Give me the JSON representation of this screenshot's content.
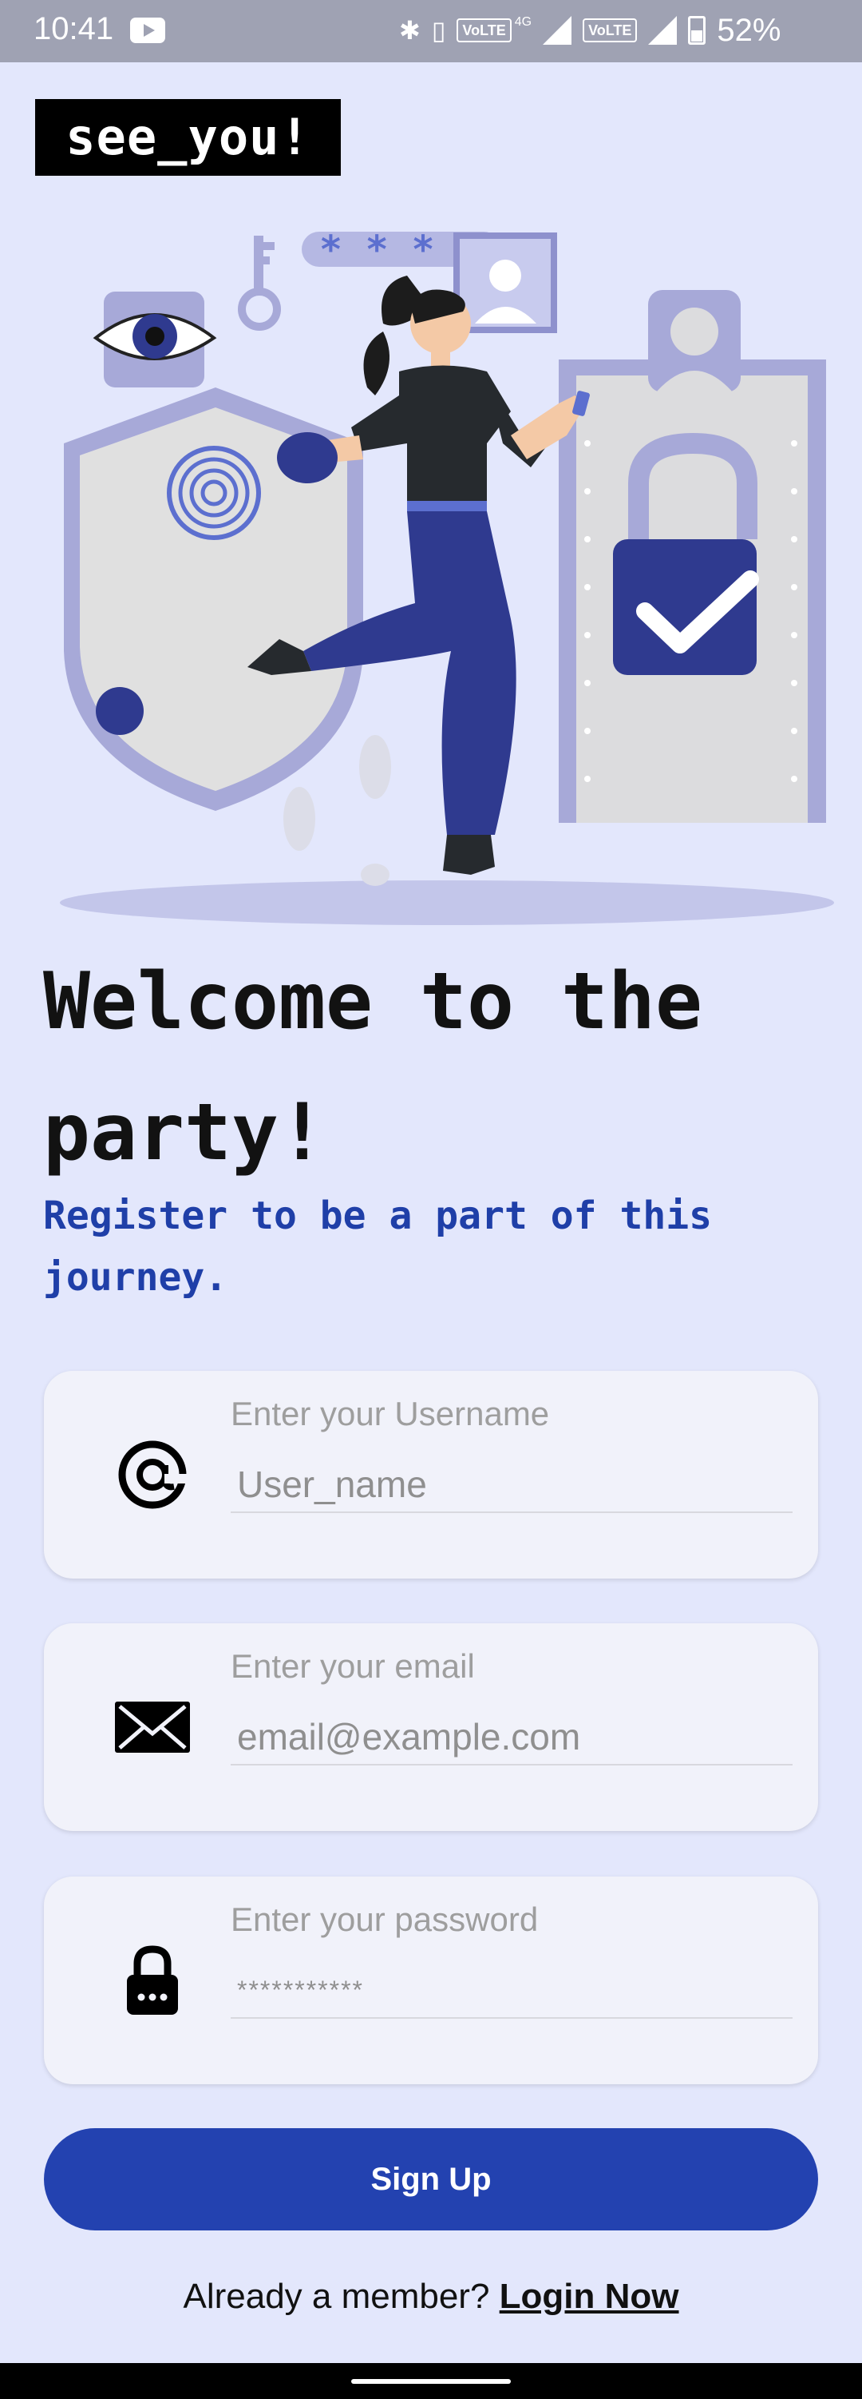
{
  "status_bar": {
    "time": "10:41",
    "volte_1": "VoLTE",
    "network": "4G",
    "volte_2": "VoLTE",
    "battery": "52%"
  },
  "logo": {
    "text": "see_you!"
  },
  "illustration": {
    "stars": "* * * *"
  },
  "welcome": {
    "title": "Welcome to the party!",
    "subtitle": "Register to be a part of this journey."
  },
  "form": {
    "username": {
      "label": "Enter your Username",
      "placeholder": "User_name",
      "icon": "at-sign-icon"
    },
    "email": {
      "label": "Enter your email",
      "placeholder": "email@example.com",
      "icon": "envelope-icon"
    },
    "password": {
      "label": "Enter your password",
      "placeholder": "***********",
      "icon": "lock-icon"
    },
    "signup_label": "Sign Up"
  },
  "footer": {
    "prompt": "Already a member?",
    "login_label": "Login Now"
  },
  "colors": {
    "background": "#e3e7fc",
    "accent": "#2342b0",
    "subtitle": "#1f3fa8",
    "card": "#f1f2fa"
  }
}
